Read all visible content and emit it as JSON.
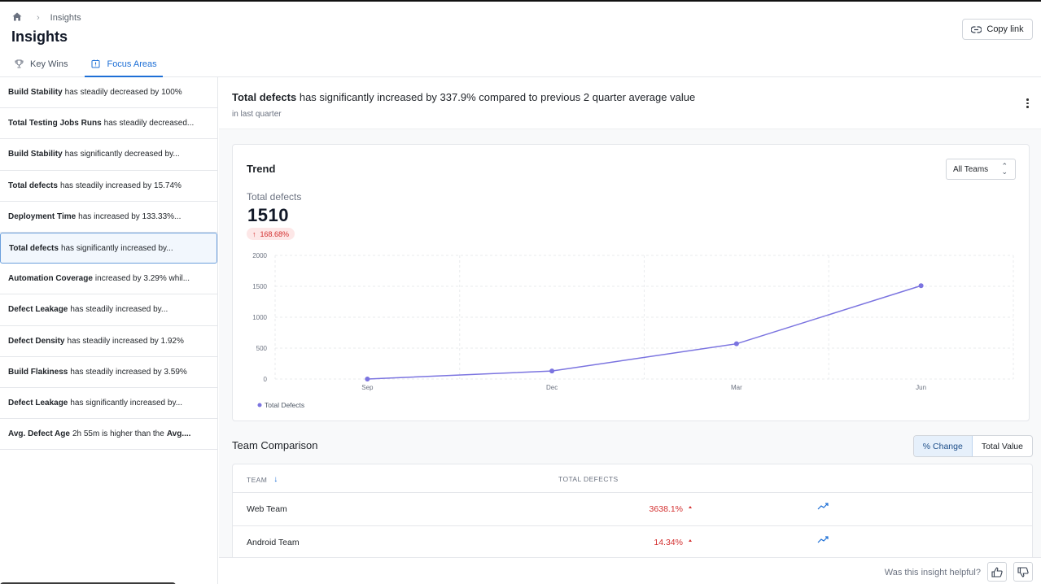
{
  "breadcrumb": {
    "current": "Insights"
  },
  "page": {
    "title": "Insights"
  },
  "tabs": [
    {
      "label": "Key Wins",
      "icon": "trophy-icon"
    },
    {
      "label": "Focus Areas",
      "icon": "focus-icon"
    }
  ],
  "header": {
    "copy_link_label": "Copy link"
  },
  "sidebar": {
    "items": [
      {
        "bold": "Build Stability",
        "text": "has steadily decreased by 100%"
      },
      {
        "bold": "Total Testing Jobs Runs",
        "text": "has steadily decreased..."
      },
      {
        "bold": "Build Stability",
        "text": "has significantly decreased by..."
      },
      {
        "bold": "Total defects",
        "text": "has steadily increased by 15.74%"
      },
      {
        "bold": "Deployment Time",
        "text": "has increased by 133.33%..."
      },
      {
        "bold": "Total defects",
        "text": "has significantly increased by..."
      },
      {
        "bold": "Automation Coverage",
        "text": "increased by 3.29% whil..."
      },
      {
        "bold": "Defect Leakage",
        "text": "has steadily increased by..."
      },
      {
        "bold": "Defect Density",
        "text": "has steadily increased by 1.92%"
      },
      {
        "bold": "Build Flakiness",
        "text": "has steadily increased by 3.59%"
      },
      {
        "bold": "Defect Leakage",
        "text": "has significantly increased by..."
      },
      {
        "bold": "Avg. Defect Age",
        "text": "2h 55m is higher than the",
        "bold2": "Avg...."
      }
    ],
    "active_index": 5
  },
  "insight": {
    "title_bold": "Total defects",
    "title_rest": "has significantly increased by 337.9% compared to previous 2 quarter average value",
    "subtitle": "in last quarter"
  },
  "trend": {
    "title": "Trend",
    "team_select": "All Teams",
    "metric_label": "Total defects",
    "metric_value": "1510",
    "change_badge": "168.68%"
  },
  "chart_data": {
    "type": "line",
    "categories": [
      "Sep",
      "Dec",
      "Mar",
      "Jun"
    ],
    "series": [
      {
        "name": "Total Defects",
        "values": [
          0,
          130,
          570,
          1510
        ],
        "color": "#7b74e0"
      }
    ],
    "ylim": [
      0,
      2000
    ],
    "yticks": [
      0,
      500,
      1000,
      1500,
      2000
    ],
    "grid": true,
    "legend": "bottom-left"
  },
  "team_comparison": {
    "title": "Team Comparison",
    "toggle": {
      "options": [
        "% Change",
        "Total Value"
      ],
      "selected": "% Change"
    },
    "columns": [
      "TEAM",
      "TOTAL DEFECTS"
    ],
    "rows": [
      {
        "team": "Web Team",
        "value": "3638.1%"
      },
      {
        "team": "Android Team",
        "value": "14.34%"
      }
    ]
  },
  "footer": {
    "question": "Was this insight helpful?"
  },
  "colors": {
    "accent": "#1d6fd6",
    "negative": "#d32f2f",
    "series": "#7b74e0"
  }
}
